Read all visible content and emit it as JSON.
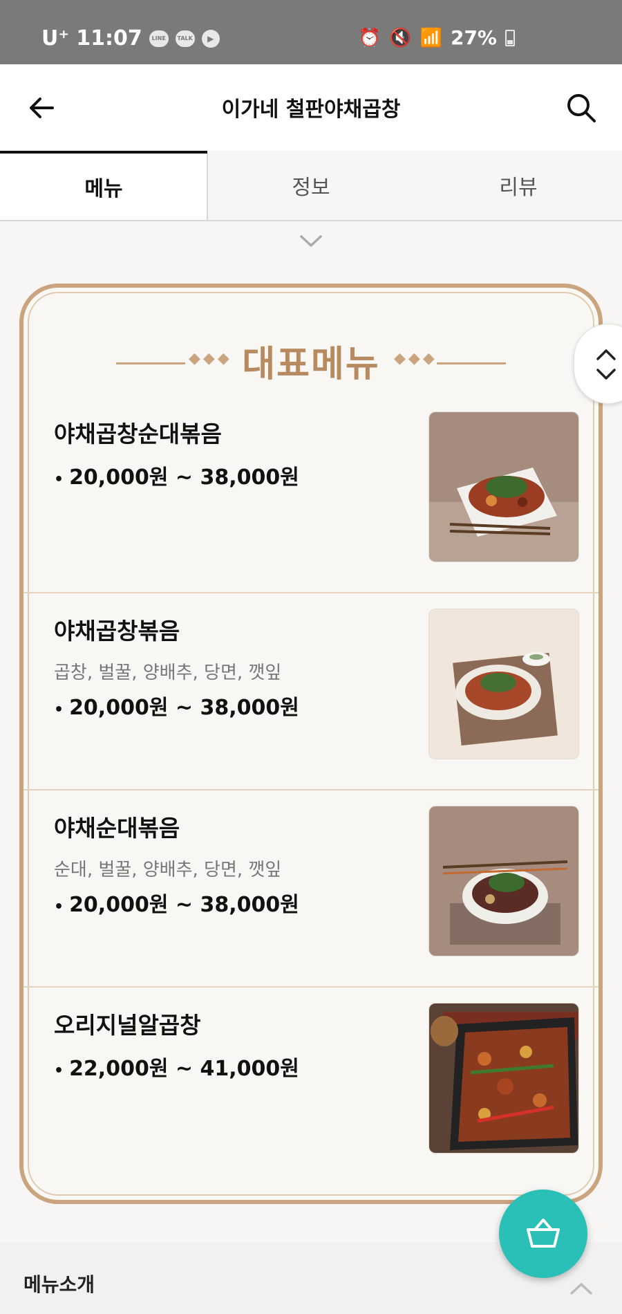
{
  "status_bar": {
    "carrier": "U⁺",
    "time": "11:07",
    "app_icons": [
      {
        "name": "line-app-icon",
        "label": "LINE"
      },
      {
        "name": "kakaotalk-app-icon",
        "label": "TALK"
      }
    ],
    "battery": "27%"
  },
  "header": {
    "title": "이가네 철판야채곱창",
    "back_icon": "arrow-left-icon",
    "search_icon": "search-icon"
  },
  "tabs": [
    {
      "label": "메뉴",
      "active": true
    },
    {
      "label": "정보",
      "active": false
    },
    {
      "label": "리뷰",
      "active": false
    }
  ],
  "menu_section": {
    "heading": "대표메뉴",
    "items": [
      {
        "name": "야채곱창순대볶음",
        "description": "",
        "price": "20,000원 ~ 38,000원"
      },
      {
        "name": "야채곱창볶음",
        "description": "곱창, 벌꿀, 양배추, 당면, 깻잎",
        "price": "20,000원 ~ 38,000원"
      },
      {
        "name": "야채순대볶음",
        "description": "순대, 벌꿀, 양배추, 당면, 깻잎",
        "price": "20,000원 ~ 38,000원"
      },
      {
        "name": "오리지널알곱창",
        "description": "",
        "price": "22,000원 ~ 41,000원"
      }
    ]
  },
  "bottom_bar": {
    "label": "메뉴소개"
  },
  "colors": {
    "accent_gold": "#c9a47e",
    "cart_teal": "#2abfb7",
    "status_bar_gray": "#7a7a7a"
  }
}
